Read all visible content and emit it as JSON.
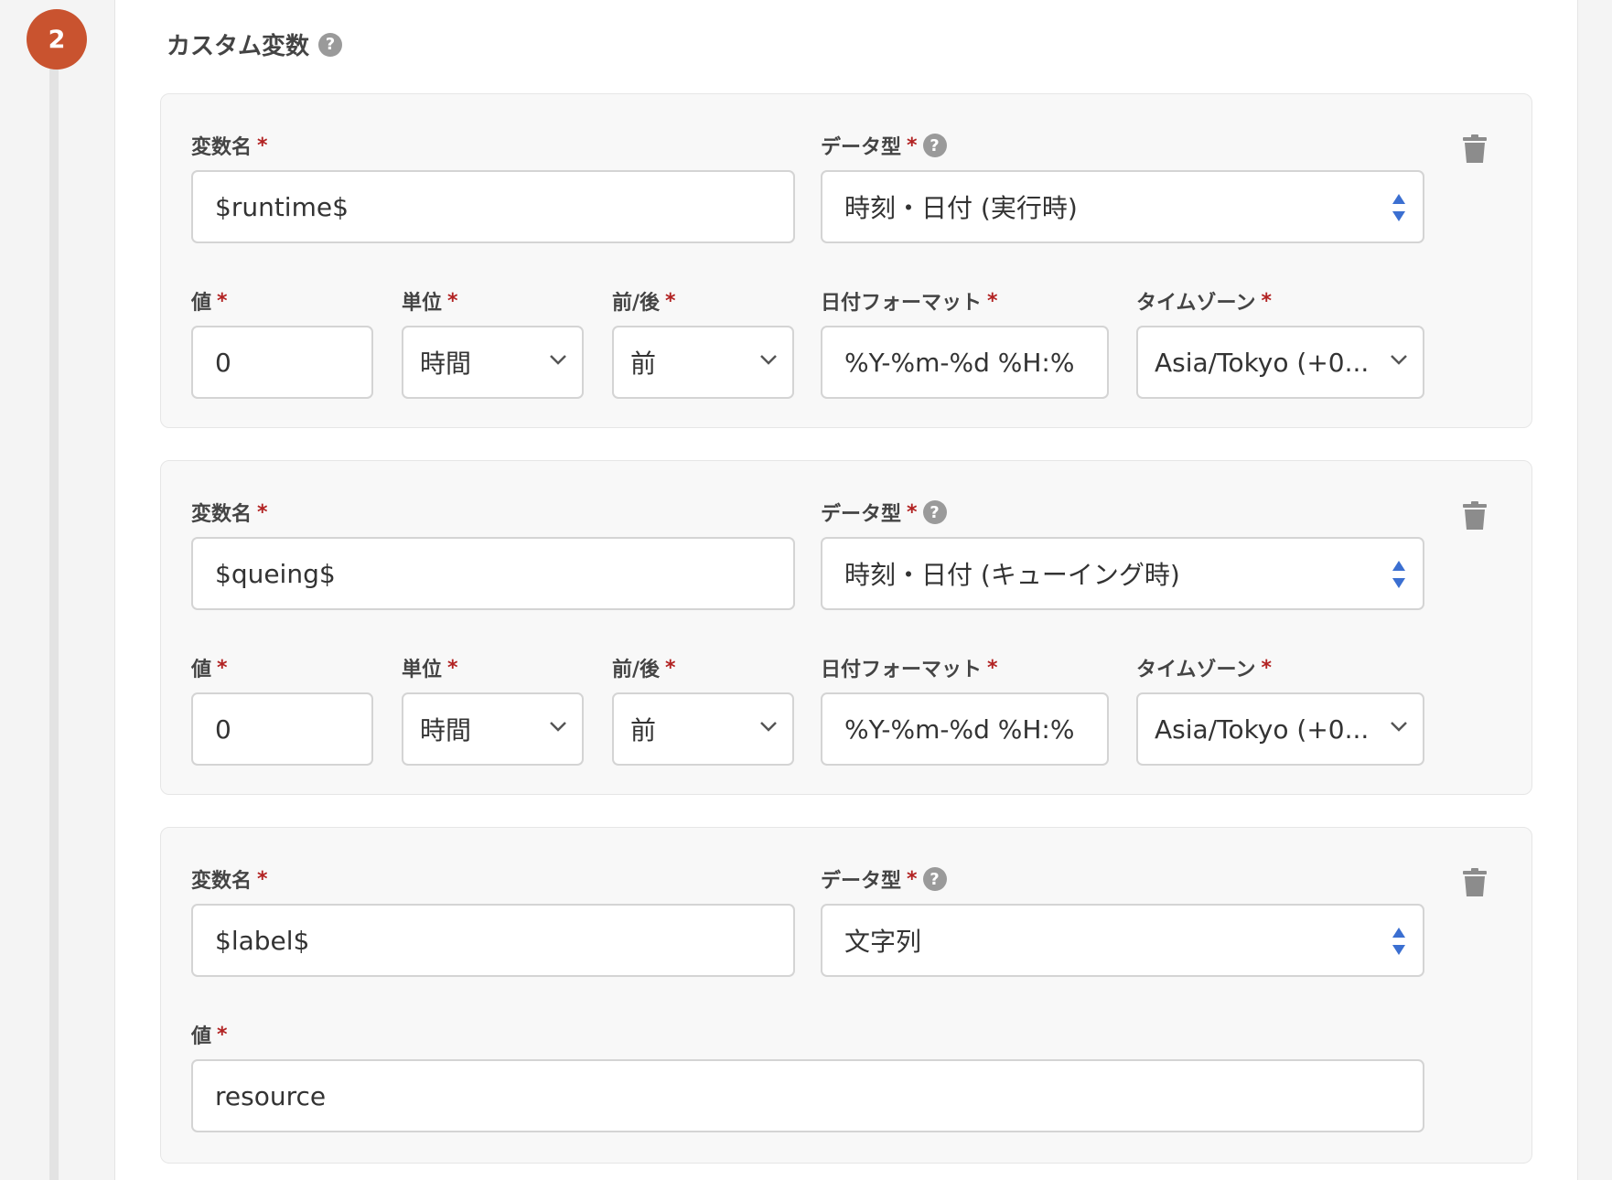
{
  "step": {
    "number": "2"
  },
  "section": {
    "title": "カスタム変数"
  },
  "labels": {
    "var_name": "変数名",
    "data_type": "データ型",
    "value": "値",
    "unit": "単位",
    "before_after": "前/後",
    "date_format": "日付フォーマット",
    "timezone": "タイムゾーン",
    "required_mark": "*",
    "help_mark": "?"
  },
  "variables": [
    {
      "name": "$runtime$",
      "data_type": "時刻・日付 (実行時)",
      "value": "0",
      "unit": "時間",
      "before_after": "前",
      "date_format": "%Y-%m-%d %H:%",
      "timezone": "Asia/Tokyo (+0..."
    },
    {
      "name": "$queing$",
      "data_type": "時刻・日付 (キューイング時)",
      "value": "0",
      "unit": "時間",
      "before_after": "前",
      "date_format": "%Y-%m-%d %H:%",
      "timezone": "Asia/Tokyo (+0..."
    },
    {
      "name": "$label$",
      "data_type": "文字列",
      "value": "resource"
    }
  ],
  "icons": {
    "delete": "trash-icon",
    "select_arrow": "chevron-down-icon",
    "select_spinner": "sort-arrows-icon",
    "help": "question-circle-icon"
  },
  "colors": {
    "step_badge": "#c9532f",
    "required": "#b22222",
    "spinner": "#3b6fd1"
  }
}
